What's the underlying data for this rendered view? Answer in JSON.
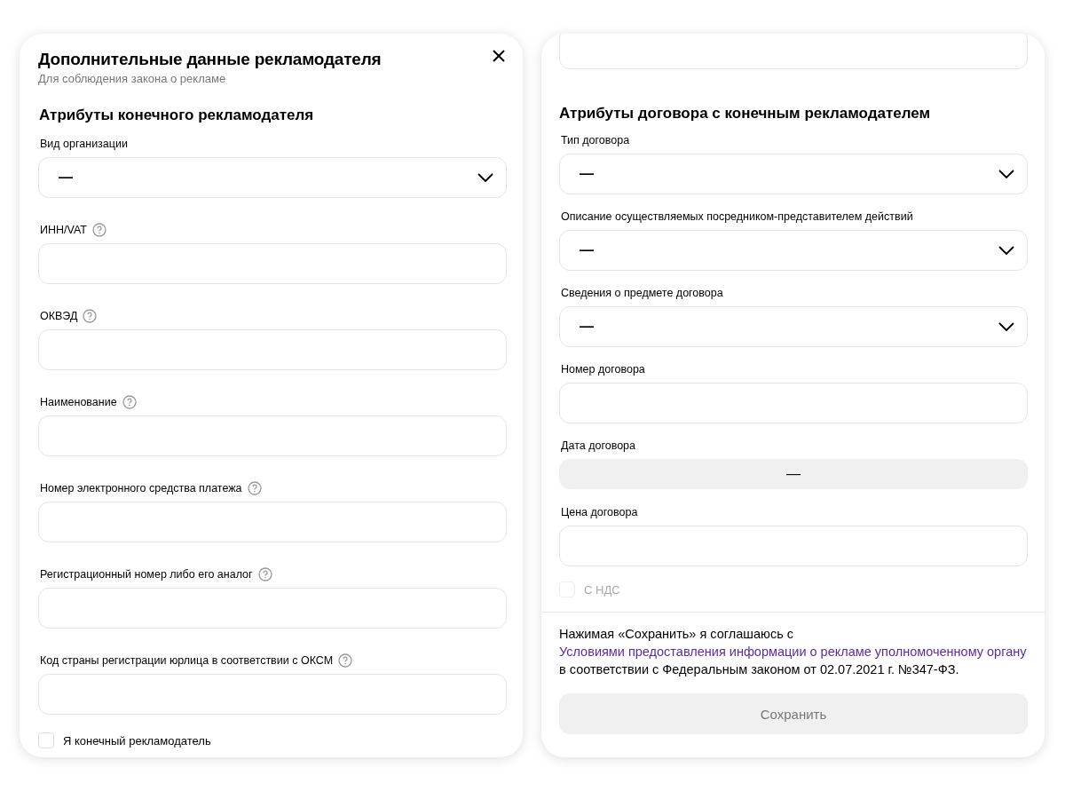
{
  "left_panel": {
    "title": "Дополнительные данные рекламодателя",
    "subtitle": "Для соблюдения закона о рекламе",
    "section_title": "Атрибуты конечного рекламодателя",
    "fields": [
      {
        "kind": "select",
        "label": "Вид организации",
        "value": "—",
        "help": false
      },
      {
        "kind": "text",
        "label": "ИНН/VAT",
        "help": true
      },
      {
        "kind": "text",
        "label": "ОКВЭД",
        "help": true
      },
      {
        "kind": "text",
        "label": "Наименование",
        "help": true
      },
      {
        "kind": "text",
        "label": "Номер электронного средства платежа",
        "help": true
      },
      {
        "kind": "text",
        "label": "Регистрационный номер либо его аналог",
        "help": true
      },
      {
        "kind": "text",
        "label": "Код страны регистрации юрлица в соответствии с ОКСМ",
        "help": true
      }
    ],
    "checkbox": {
      "label": "Я конечный рекламодатель",
      "checked": false,
      "disabled": false
    }
  },
  "right_panel": {
    "section_title": "Атрибуты договора с конечным рекламодателем",
    "fields": [
      {
        "kind": "select",
        "label": "Тип договора",
        "value": "—"
      },
      {
        "kind": "select",
        "label": "Описание осуществляемых посредником-представителем действий",
        "value": "—"
      },
      {
        "kind": "select",
        "label": "Сведения о предмете договора",
        "value": "—"
      },
      {
        "kind": "text",
        "label": "Номер договора"
      },
      {
        "kind": "date",
        "label": "Дата договора",
        "value": "—"
      },
      {
        "kind": "text",
        "label": "Цена договора"
      }
    ],
    "checkbox": {
      "label": "С НДС",
      "checked": false,
      "disabled": true
    },
    "legal": {
      "before": "Нажимая «Сохранить» я соглашаюсь с ",
      "link": "Условиями предоставления информации о рекламе уполномоченному органу",
      "after": " в соответствии с Федеральным законом от 02.07.2021 г. №347-ФЗ."
    },
    "save_button": {
      "label": "Сохранить",
      "disabled": true
    }
  }
}
